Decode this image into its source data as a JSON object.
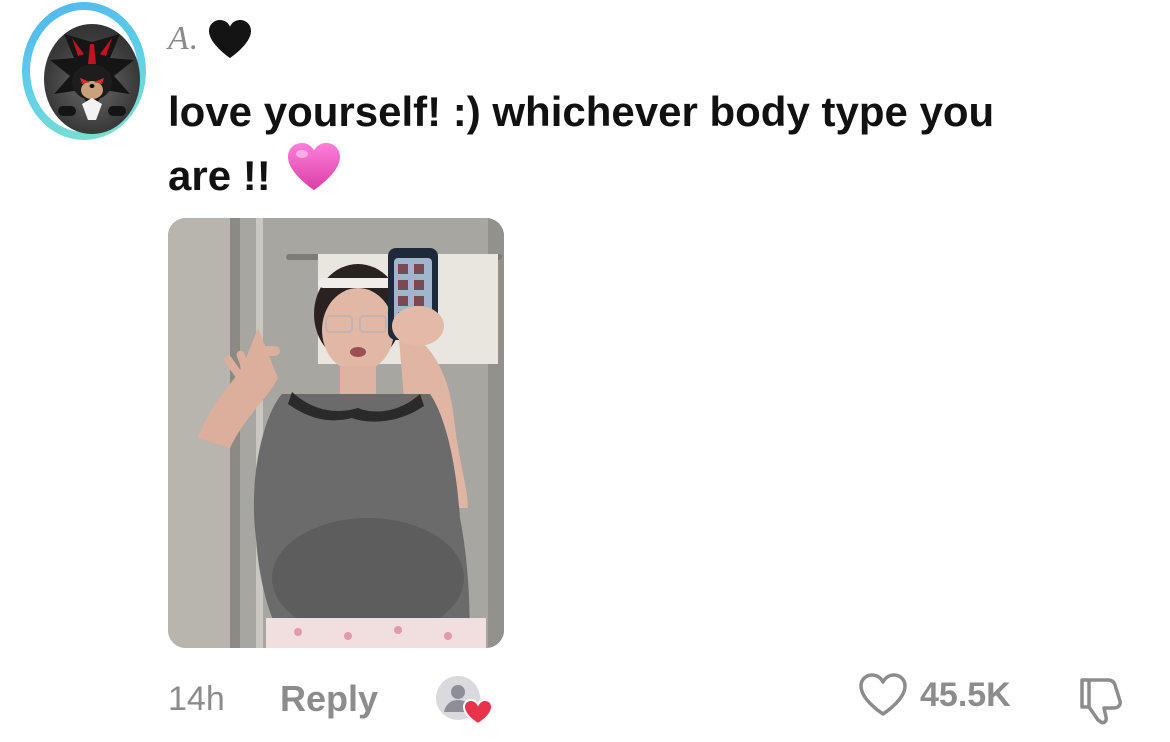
{
  "comment": {
    "username": "A.",
    "username_emoji": "black-heart-icon",
    "text_line1": "love yourself! :) whichever body type you",
    "text_line2": "are !!",
    "text_emoji": "pink-heart-icon",
    "avatar_icon": "shadow-hedgehog-avatar",
    "image_icon": "mirror-selfie-photo"
  },
  "footer": {
    "time": "14h",
    "reply_label": "Reply",
    "reactor_icon": "creator-liked-icon",
    "like_icon": "heart-outline-icon",
    "like_count": "45.5K",
    "dislike_icon": "thumbs-down-icon"
  },
  "colors": {
    "text": "#111111",
    "muted": "#8c8c8c",
    "ring_start": "#4fb4f0",
    "ring_end": "#7fe3c8",
    "pink_heart": "#e84fbf",
    "reactor_heart": "#e8334a"
  }
}
